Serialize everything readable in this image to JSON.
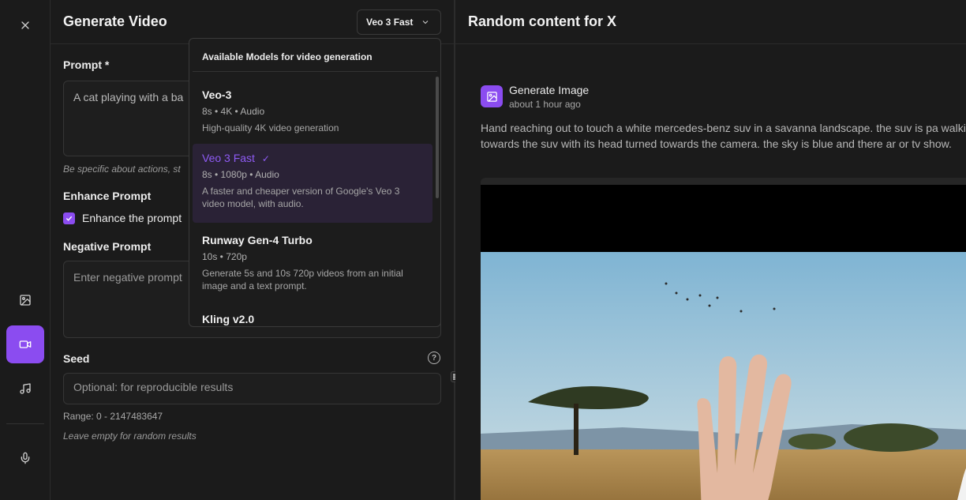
{
  "panel": {
    "title": "Generate Video",
    "selected_model": "Veo 3 Fast"
  },
  "form": {
    "prompt_label": "Prompt *",
    "prompt_value": "A cat playing with a ba",
    "prompt_hint": "Be specific about actions, st",
    "enhance_label": "Enhance Prompt",
    "enhance_checkbox_label": "Enhance the prompt",
    "enhance_checked": true,
    "negative_label": "Negative Prompt",
    "negative_placeholder": "Enter negative prompt",
    "seed_label": "Seed",
    "seed_placeholder": "Optional: for reproducible results",
    "seed_range": "Range: 0 - 2147483647",
    "seed_hint": "Leave empty for random results",
    "help_glyph": "?"
  },
  "dropdown": {
    "heading": "Available Models for video generation",
    "check_glyph": "✓",
    "items": [
      {
        "name": "Veo-3",
        "meta": "8s • 4K • Audio",
        "desc": "High-quality 4K video generation"
      },
      {
        "name": "Veo 3 Fast",
        "meta": "8s • 1080p • Audio",
        "desc": "A faster and cheaper version of Google's Veo 3 video model, with audio."
      },
      {
        "name": "Runway Gen-4 Turbo",
        "meta": "10s • 720p",
        "desc": "Generate 5s and 10s 720p videos from an initial image and a text prompt."
      },
      {
        "name": "Kling v2.0",
        "meta": "",
        "desc": ""
      }
    ]
  },
  "right": {
    "title": "Random content for X",
    "generation": {
      "title": "Generate Image",
      "time": "about 1 hour ago",
      "prompt": "Hand reaching out to touch a white mercedes-benz suv in a savanna landscape. the suv is pa walking towards the suv with its head turned towards the camera. the sky is blue and there ar or tv show."
    }
  },
  "icons": {
    "close": "close-icon",
    "image": "image-icon",
    "video": "video-icon",
    "music": "music-icon",
    "mic": "microphone-icon"
  },
  "colors": {
    "accent": "#8b4cf0",
    "background": "#1b1b1b"
  }
}
